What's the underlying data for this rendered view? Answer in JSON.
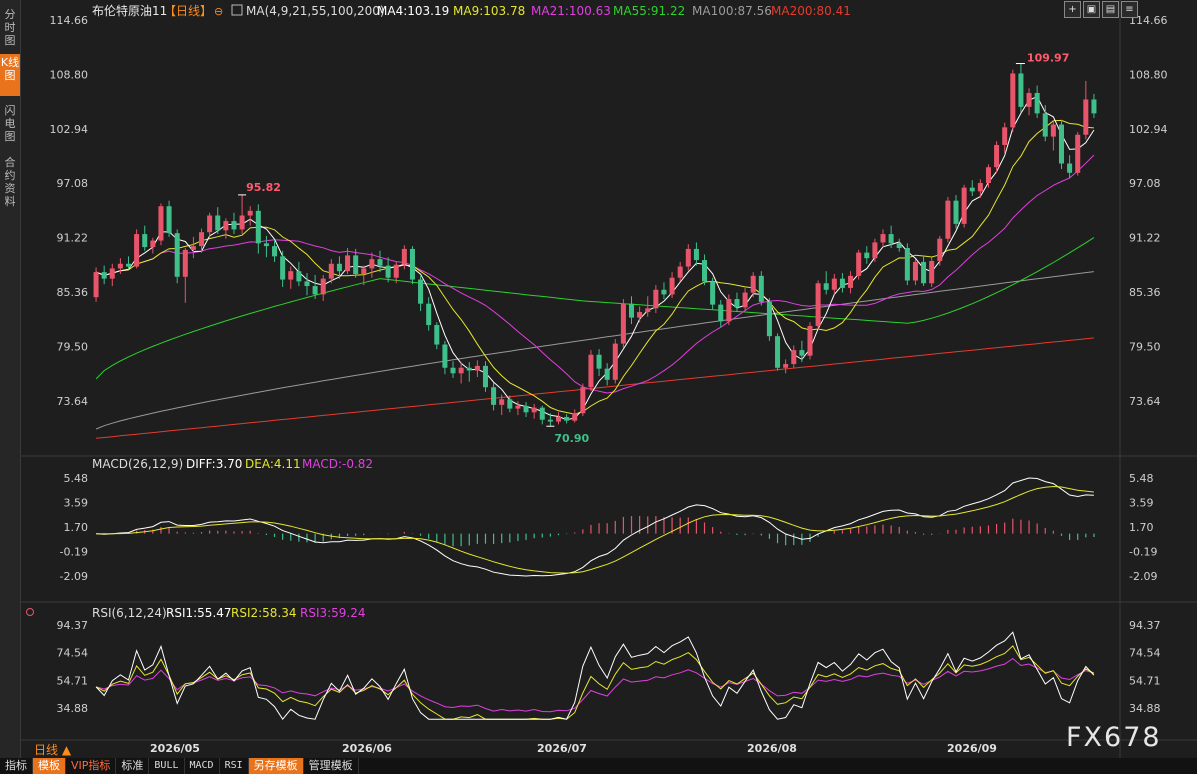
{
  "app": {
    "instrument": "布伦特原油11",
    "period_tag": "【日线】",
    "circle_icon": "⊖",
    "watermark": "FX678"
  },
  "sidebar": {
    "items": [
      {
        "label": "分时图",
        "active": false
      },
      {
        "label": "K线图",
        "active": true
      },
      {
        "label": "闪电图",
        "active": false
      },
      {
        "label": "合约资料",
        "active": false
      }
    ]
  },
  "toolbar_icons": [
    "crosshair-icon",
    "zoom-in-icon",
    "zoom-out-icon",
    "menu-icon"
  ],
  "ma_legend": [
    {
      "label": "MA(4,9,21,55,100,200)",
      "color": "#dcdcdc"
    },
    {
      "label": "MA4:103.19",
      "color": "#ffffff"
    },
    {
      "label": "MA9:103.78",
      "color": "#e6e62e"
    },
    {
      "label": "MA21:100.63",
      "color": "#e040e0"
    },
    {
      "label": "MA55:91.22",
      "color": "#2ed12e"
    },
    {
      "label": "MA100:87.56",
      "color": "#9a9a9a"
    },
    {
      "label": "MA200:80.41",
      "color": "#e63b2e"
    }
  ],
  "macd_legend": [
    {
      "label": "MACD(26,12,9)",
      "color": "#dcdcdc"
    },
    {
      "label": "DIFF:3.70",
      "color": "#ffffff"
    },
    {
      "label": "DEA:4.11",
      "color": "#e6e62e"
    },
    {
      "label": "MACD:-0.82",
      "color": "#e040e0"
    }
  ],
  "rsi_legend": [
    {
      "label": "RSI(6,12,24)",
      "color": "#dcdcdc"
    },
    {
      "label": "RSI1:55.47",
      "color": "#ffffff"
    },
    {
      "label": "RSI2:58.34",
      "color": "#e6e62e"
    },
    {
      "label": "RSI3:59.24",
      "color": "#e040e0"
    }
  ],
  "price_axis": {
    "ticks": [
      "114.66",
      "108.80",
      "102.94",
      "97.08",
      "91.22",
      "85.36",
      "79.50",
      "73.64"
    ]
  },
  "macd_axis": {
    "ticks": [
      "5.48",
      "3.59",
      "1.70",
      "-0.19",
      "-2.09"
    ]
  },
  "rsi_axis": {
    "ticks": [
      "94.37",
      "74.54",
      "54.71",
      "34.88"
    ]
  },
  "date_axis": {
    "labels": [
      "2026/05",
      "2026/06",
      "2026/07",
      "2026/08",
      "2026/09"
    ]
  },
  "annotations": {
    "high_label": "109.97",
    "low_label": "70.90",
    "mid_high_label": "95.82"
  },
  "bottom_bar": {
    "items": [
      {
        "label": "指标",
        "style": "normal"
      },
      {
        "label": "模板",
        "style": "orange"
      },
      {
        "label": "VIP指标",
        "style": "vip"
      },
      {
        "label": "标准",
        "style": "normal"
      },
      {
        "label": "BULL",
        "style": "mono"
      },
      {
        "label": "MACD",
        "style": "mono"
      },
      {
        "label": "RSI",
        "style": "mono"
      },
      {
        "label": "另存模板",
        "style": "orange"
      },
      {
        "label": "管理模板",
        "style": "normal"
      }
    ],
    "dayline_label": "日线 ▲"
  },
  "colors": {
    "up": "#e8546a",
    "down": "#3fbf8a",
    "bg": "#1e1e1e"
  },
  "chart_data": {
    "type": "candlestick",
    "x_labels_months": [
      "2026/05",
      "2026/06",
      "2026/07",
      "2026/08",
      "2026/09"
    ],
    "price_range": [
      67.8,
      114.66
    ],
    "candles": [
      {
        "o": 84.8,
        "h": 88.0,
        "l": 84.3,
        "c": 87.5
      },
      {
        "o": 87.5,
        "h": 88.2,
        "l": 86.2,
        "c": 86.8
      },
      {
        "o": 86.8,
        "h": 88.4,
        "l": 86.0,
        "c": 87.9
      },
      {
        "o": 87.9,
        "h": 89.0,
        "l": 87.3,
        "c": 88.4
      },
      {
        "o": 88.4,
        "h": 89.2,
        "l": 87.8,
        "c": 88.1
      },
      {
        "o": 88.1,
        "h": 92.1,
        "l": 87.9,
        "c": 91.6
      },
      {
        "o": 91.6,
        "h": 92.5,
        "l": 89.8,
        "c": 90.2
      },
      {
        "o": 90.2,
        "h": 91.2,
        "l": 89.5,
        "c": 90.9
      },
      {
        "o": 90.9,
        "h": 94.9,
        "l": 90.4,
        "c": 94.6
      },
      {
        "o": 94.6,
        "h": 95.2,
        "l": 91.3,
        "c": 91.7
      },
      {
        "o": 91.7,
        "h": 92.1,
        "l": 86.3,
        "c": 87.0
      },
      {
        "o": 87.0,
        "h": 90.1,
        "l": 84.2,
        "c": 89.9
      },
      {
        "o": 89.9,
        "h": 91.3,
        "l": 89.0,
        "c": 90.3
      },
      {
        "o": 90.3,
        "h": 92.2,
        "l": 89.6,
        "c": 91.8
      },
      {
        "o": 91.8,
        "h": 93.9,
        "l": 91.2,
        "c": 93.6
      },
      {
        "o": 93.6,
        "h": 94.5,
        "l": 91.6,
        "c": 92.0
      },
      {
        "o": 92.0,
        "h": 93.3,
        "l": 91.1,
        "c": 93.0
      },
      {
        "o": 93.0,
        "h": 93.9,
        "l": 91.6,
        "c": 92.1
      },
      {
        "o": 92.1,
        "h": 95.82,
        "l": 91.6,
        "c": 93.6
      },
      {
        "o": 93.6,
        "h": 94.6,
        "l": 92.5,
        "c": 94.1
      },
      {
        "o": 94.1,
        "h": 94.8,
        "l": 89.5,
        "c": 90.6
      },
      {
        "o": 90.6,
        "h": 91.4,
        "l": 89.1,
        "c": 90.3
      },
      {
        "o": 90.3,
        "h": 91.0,
        "l": 88.6,
        "c": 89.2
      },
      {
        "o": 89.2,
        "h": 89.8,
        "l": 85.9,
        "c": 86.7
      },
      {
        "o": 86.7,
        "h": 88.1,
        "l": 85.7,
        "c": 87.6
      },
      {
        "o": 87.6,
        "h": 88.6,
        "l": 86.0,
        "c": 86.5
      },
      {
        "o": 86.5,
        "h": 87.4,
        "l": 85.0,
        "c": 86.0
      },
      {
        "o": 86.0,
        "h": 87.2,
        "l": 84.6,
        "c": 85.1
      },
      {
        "o": 85.1,
        "h": 87.2,
        "l": 84.4,
        "c": 86.8
      },
      {
        "o": 86.8,
        "h": 88.9,
        "l": 86.3,
        "c": 88.4
      },
      {
        "o": 88.4,
        "h": 89.2,
        "l": 86.8,
        "c": 87.6
      },
      {
        "o": 87.6,
        "h": 90.1,
        "l": 87.3,
        "c": 89.3
      },
      {
        "o": 89.3,
        "h": 90.0,
        "l": 86.9,
        "c": 87.3
      },
      {
        "o": 87.3,
        "h": 88.2,
        "l": 86.1,
        "c": 87.9
      },
      {
        "o": 87.9,
        "h": 89.6,
        "l": 86.9,
        "c": 88.9
      },
      {
        "o": 88.9,
        "h": 89.8,
        "l": 87.5,
        "c": 88.2
      },
      {
        "o": 88.2,
        "h": 89.1,
        "l": 86.4,
        "c": 86.9
      },
      {
        "o": 86.9,
        "h": 88.6,
        "l": 86.3,
        "c": 88.3
      },
      {
        "o": 88.3,
        "h": 90.4,
        "l": 87.8,
        "c": 90.0
      },
      {
        "o": 90.0,
        "h": 90.3,
        "l": 86.2,
        "c": 86.7
      },
      {
        "o": 86.7,
        "h": 87.1,
        "l": 83.3,
        "c": 84.1
      },
      {
        "o": 84.1,
        "h": 84.8,
        "l": 81.2,
        "c": 81.8
      },
      {
        "o": 81.8,
        "h": 82.1,
        "l": 79.2,
        "c": 79.7
      },
      {
        "o": 79.7,
        "h": 80.1,
        "l": 76.5,
        "c": 77.2
      },
      {
        "o": 77.2,
        "h": 77.9,
        "l": 76.1,
        "c": 76.6
      },
      {
        "o": 76.6,
        "h": 77.8,
        "l": 75.5,
        "c": 77.2
      },
      {
        "o": 77.2,
        "h": 77.8,
        "l": 75.7,
        "c": 76.9
      },
      {
        "o": 76.9,
        "h": 78.0,
        "l": 76.2,
        "c": 77.4
      },
      {
        "o": 77.4,
        "h": 77.9,
        "l": 74.6,
        "c": 75.1
      },
      {
        "o": 75.1,
        "h": 75.6,
        "l": 72.6,
        "c": 73.2
      },
      {
        "o": 73.2,
        "h": 74.3,
        "l": 72.1,
        "c": 73.8
      },
      {
        "o": 73.8,
        "h": 74.2,
        "l": 72.4,
        "c": 72.8
      },
      {
        "o": 72.8,
        "h": 73.6,
        "l": 72.1,
        "c": 73.1
      },
      {
        "o": 73.1,
        "h": 73.5,
        "l": 71.9,
        "c": 72.4
      },
      {
        "o": 72.4,
        "h": 73.3,
        "l": 71.7,
        "c": 72.9
      },
      {
        "o": 72.9,
        "h": 73.1,
        "l": 71.1,
        "c": 71.6
      },
      {
        "o": 71.6,
        "h": 72.3,
        "l": 70.9,
        "c": 71.4
      },
      {
        "o": 71.4,
        "h": 72.4,
        "l": 71.1,
        "c": 71.9
      },
      {
        "o": 71.9,
        "h": 72.2,
        "l": 71.2,
        "c": 71.5
      },
      {
        "o": 71.5,
        "h": 72.7,
        "l": 71.3,
        "c": 72.3
      },
      {
        "o": 72.3,
        "h": 75.5,
        "l": 72.0,
        "c": 75.1
      },
      {
        "o": 75.1,
        "h": 79.1,
        "l": 74.7,
        "c": 78.6
      },
      {
        "o": 78.6,
        "h": 79.2,
        "l": 76.3,
        "c": 77.1
      },
      {
        "o": 77.1,
        "h": 77.7,
        "l": 75.3,
        "c": 75.9
      },
      {
        "o": 75.9,
        "h": 80.3,
        "l": 75.5,
        "c": 79.8
      },
      {
        "o": 79.8,
        "h": 84.6,
        "l": 79.3,
        "c": 84.1
      },
      {
        "o": 84.1,
        "h": 84.9,
        "l": 81.9,
        "c": 82.6
      },
      {
        "o": 82.6,
        "h": 83.8,
        "l": 82.1,
        "c": 83.2
      },
      {
        "o": 83.2,
        "h": 84.9,
        "l": 82.7,
        "c": 83.6
      },
      {
        "o": 83.6,
        "h": 86.1,
        "l": 83.1,
        "c": 85.6
      },
      {
        "o": 85.6,
        "h": 86.4,
        "l": 84.6,
        "c": 85.1
      },
      {
        "o": 85.1,
        "h": 87.5,
        "l": 84.7,
        "c": 86.9
      },
      {
        "o": 86.9,
        "h": 88.6,
        "l": 86.5,
        "c": 88.1
      },
      {
        "o": 88.1,
        "h": 90.5,
        "l": 87.7,
        "c": 90.0
      },
      {
        "o": 90.0,
        "h": 90.7,
        "l": 88.2,
        "c": 88.8
      },
      {
        "o": 88.8,
        "h": 89.4,
        "l": 86.1,
        "c": 86.5
      },
      {
        "o": 86.5,
        "h": 86.9,
        "l": 83.5,
        "c": 84.0
      },
      {
        "o": 84.0,
        "h": 84.5,
        "l": 81.6,
        "c": 82.2
      },
      {
        "o": 82.2,
        "h": 85.1,
        "l": 81.8,
        "c": 84.6
      },
      {
        "o": 84.6,
        "h": 85.3,
        "l": 83.2,
        "c": 83.7
      },
      {
        "o": 83.7,
        "h": 85.8,
        "l": 83.3,
        "c": 85.3
      },
      {
        "o": 85.3,
        "h": 87.5,
        "l": 84.8,
        "c": 87.1
      },
      {
        "o": 87.1,
        "h": 87.6,
        "l": 83.9,
        "c": 84.3
      },
      {
        "o": 84.3,
        "h": 84.7,
        "l": 80.1,
        "c": 80.6
      },
      {
        "o": 80.6,
        "h": 80.9,
        "l": 76.9,
        "c": 77.2
      },
      {
        "o": 77.2,
        "h": 78.1,
        "l": 76.6,
        "c": 77.6
      },
      {
        "o": 77.6,
        "h": 79.6,
        "l": 77.2,
        "c": 79.1
      },
      {
        "o": 79.1,
        "h": 80.1,
        "l": 77.8,
        "c": 78.5
      },
      {
        "o": 78.5,
        "h": 82.1,
        "l": 78.1,
        "c": 81.7
      },
      {
        "o": 81.7,
        "h": 86.6,
        "l": 81.3,
        "c": 86.3
      },
      {
        "o": 86.3,
        "h": 87.6,
        "l": 85.1,
        "c": 85.6
      },
      {
        "o": 85.6,
        "h": 87.3,
        "l": 85.1,
        "c": 86.8
      },
      {
        "o": 86.8,
        "h": 87.4,
        "l": 85.3,
        "c": 85.8
      },
      {
        "o": 85.8,
        "h": 87.6,
        "l": 85.2,
        "c": 87.1
      },
      {
        "o": 87.1,
        "h": 89.9,
        "l": 86.7,
        "c": 89.6
      },
      {
        "o": 89.6,
        "h": 90.3,
        "l": 88.4,
        "c": 89.0
      },
      {
        "o": 89.0,
        "h": 91.1,
        "l": 88.6,
        "c": 90.7
      },
      {
        "o": 90.7,
        "h": 92.1,
        "l": 90.2,
        "c": 91.6
      },
      {
        "o": 91.6,
        "h": 92.5,
        "l": 90.1,
        "c": 90.6
      },
      {
        "o": 90.6,
        "h": 91.1,
        "l": 89.7,
        "c": 90.1
      },
      {
        "o": 90.1,
        "h": 90.6,
        "l": 86.1,
        "c": 86.6
      },
      {
        "o": 86.6,
        "h": 88.9,
        "l": 86.1,
        "c": 88.6
      },
      {
        "o": 88.6,
        "h": 89.3,
        "l": 86.0,
        "c": 86.3
      },
      {
        "o": 86.3,
        "h": 89.1,
        "l": 85.9,
        "c": 88.7
      },
      {
        "o": 88.7,
        "h": 91.4,
        "l": 88.2,
        "c": 91.1
      },
      {
        "o": 91.1,
        "h": 95.6,
        "l": 90.7,
        "c": 95.2
      },
      {
        "o": 95.2,
        "h": 95.8,
        "l": 92.2,
        "c": 92.7
      },
      {
        "o": 92.7,
        "h": 96.9,
        "l": 92.3,
        "c": 96.6
      },
      {
        "o": 96.6,
        "h": 97.4,
        "l": 95.7,
        "c": 96.2
      },
      {
        "o": 96.2,
        "h": 97.5,
        "l": 95.5,
        "c": 97.1
      },
      {
        "o": 97.1,
        "h": 99.1,
        "l": 96.6,
        "c": 98.8
      },
      {
        "o": 98.8,
        "h": 101.6,
        "l": 98.2,
        "c": 101.2
      },
      {
        "o": 101.2,
        "h": 103.6,
        "l": 100.3,
        "c": 103.1
      },
      {
        "o": 103.1,
        "h": 109.3,
        "l": 102.6,
        "c": 108.9
      },
      {
        "o": 108.9,
        "h": 109.97,
        "l": 104.7,
        "c": 105.3
      },
      {
        "o": 105.3,
        "h": 107.3,
        "l": 104.4,
        "c": 106.8
      },
      {
        "o": 106.8,
        "h": 107.6,
        "l": 104.1,
        "c": 104.6
      },
      {
        "o": 104.6,
        "h": 105.5,
        "l": 101.6,
        "c": 102.1
      },
      {
        "o": 102.1,
        "h": 103.9,
        "l": 100.6,
        "c": 103.4
      },
      {
        "o": 103.4,
        "h": 103.9,
        "l": 98.6,
        "c": 99.2
      },
      {
        "o": 99.2,
        "h": 100.1,
        "l": 97.6,
        "c": 98.2
      },
      {
        "o": 98.2,
        "h": 102.6,
        "l": 97.9,
        "c": 102.3
      },
      {
        "o": 102.3,
        "h": 108.1,
        "l": 101.8,
        "c": 106.1
      },
      {
        "o": 106.1,
        "h": 106.7,
        "l": 104.1,
        "c": 104.6
      }
    ]
  }
}
